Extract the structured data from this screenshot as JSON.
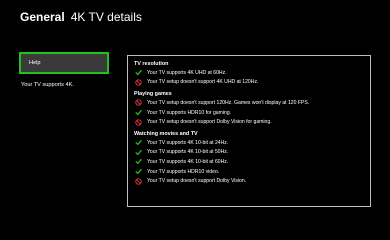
{
  "header": {
    "section": "General",
    "page": "4K TV details"
  },
  "sidebar": {
    "help_label": "Help",
    "support_text": "Your TV supports 4K."
  },
  "details": {
    "groups": [
      {
        "title": "TV resolution",
        "items": [
          {
            "status": "supported",
            "text": "Your TV supports 4K UHD at 60Hz."
          },
          {
            "status": "not-supported",
            "text": "Your TV setup doesn't support 4K UHD at 120Hz."
          }
        ]
      },
      {
        "title": "Playing games",
        "items": [
          {
            "status": "not-supported",
            "text": "Your TV setup doesn't support 120Hz. Games won't display at 120 FPS."
          },
          {
            "status": "supported",
            "text": "Your TV supports HDR10 for gaming."
          },
          {
            "status": "not-supported",
            "text": "Your TV setup doesn't support Dolby Vision for gaming."
          }
        ]
      },
      {
        "title": "Watching movies and TV",
        "items": [
          {
            "status": "supported",
            "text": "Your TV supports 4K 10-bit at 24Hz."
          },
          {
            "status": "supported",
            "text": "Your TV supports 4K 10-bit at 50Hz."
          },
          {
            "status": "supported",
            "text": "Your TV supports 4K 10-bit at 60Hz."
          },
          {
            "status": "supported",
            "text": "Your TV supports HDR10 video."
          },
          {
            "status": "not-supported",
            "text": "Your TV setup doesn't support Dolby Vision."
          }
        ]
      }
    ]
  },
  "icons": {
    "supported": "checkmark-icon",
    "not-supported": "prohibited-icon"
  },
  "colors": {
    "accent": "#1fc21f",
    "check": "#1fc21f",
    "prohibited": "#e23b3b",
    "background": "#000000",
    "button": "#3a3a3a"
  }
}
